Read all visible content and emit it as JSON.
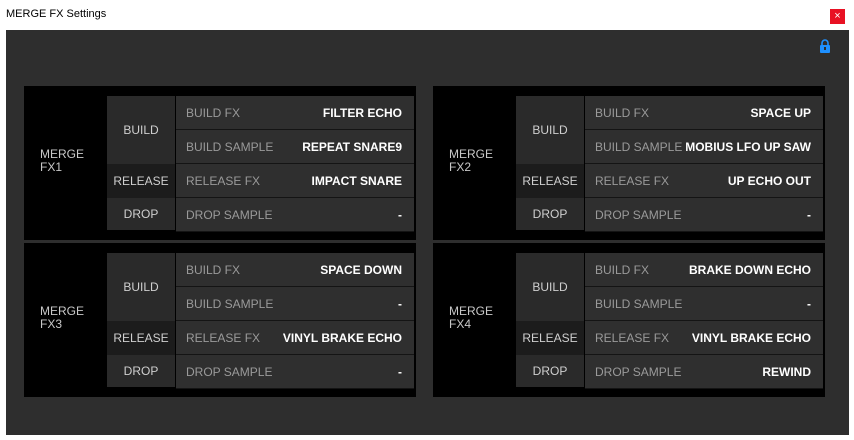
{
  "window": {
    "title": "MERGE FX Settings",
    "close_label": "×"
  },
  "panels": [
    {
      "name": "MERGE\nFX1",
      "build_label": "BUILD",
      "release_label": "RELEASE",
      "drop_label": "DROP",
      "rows": [
        {
          "label": "BUILD FX",
          "value": "FILTER ECHO"
        },
        {
          "label": "BUILD SAMPLE",
          "value": "REPEAT SNARE9"
        },
        {
          "label": "RELEASE FX",
          "value": "IMPACT SNARE"
        },
        {
          "label": "DROP SAMPLE",
          "value": "-"
        }
      ]
    },
    {
      "name": "MERGE\nFX2",
      "build_label": "BUILD",
      "release_label": "RELEASE",
      "drop_label": "DROP",
      "rows": [
        {
          "label": "BUILD FX",
          "value": "SPACE UP"
        },
        {
          "label": "BUILD SAMPLE",
          "value": "MOBIUS LFO UP SAW"
        },
        {
          "label": "RELEASE FX",
          "value": "UP ECHO OUT"
        },
        {
          "label": "DROP SAMPLE",
          "value": "-"
        }
      ]
    },
    {
      "name": "MERGE\nFX3",
      "build_label": "BUILD",
      "release_label": "RELEASE",
      "drop_label": "DROP",
      "rows": [
        {
          "label": "BUILD FX",
          "value": "SPACE DOWN"
        },
        {
          "label": "BUILD SAMPLE",
          "value": "-"
        },
        {
          "label": "RELEASE FX",
          "value": "VINYL BRAKE ECHO"
        },
        {
          "label": "DROP SAMPLE",
          "value": "-"
        }
      ]
    },
    {
      "name": "MERGE\nFX4",
      "build_label": "BUILD",
      "release_label": "RELEASE",
      "drop_label": "DROP",
      "rows": [
        {
          "label": "BUILD FX",
          "value": "BRAKE DOWN ECHO"
        },
        {
          "label": "BUILD SAMPLE",
          "value": "-"
        },
        {
          "label": "RELEASE FX",
          "value": "VINYL BRAKE ECHO"
        },
        {
          "label": "DROP SAMPLE",
          "value": "REWIND"
        }
      ]
    }
  ],
  "icons": {
    "lock": "lock-icon",
    "close": "close-icon"
  },
  "colors": {
    "accent": "#1e90ff",
    "close": "#e81123"
  }
}
